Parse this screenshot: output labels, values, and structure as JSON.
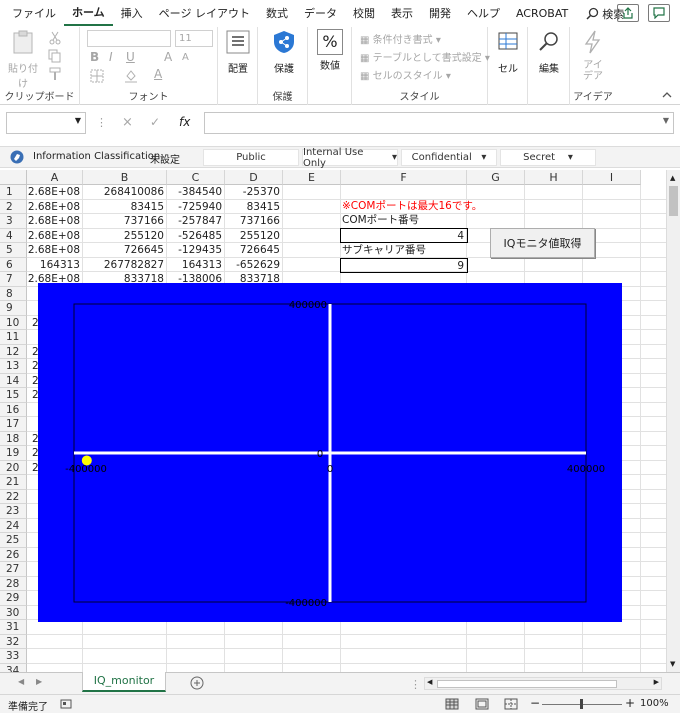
{
  "menu": {
    "items": [
      "ファイル",
      "ホーム",
      "挿入",
      "ページ レイアウト",
      "数式",
      "データ",
      "校閲",
      "表示",
      "開発",
      "ヘルプ",
      "ACROBAT"
    ],
    "active": "ホーム",
    "search": "検索"
  },
  "ribbon": {
    "clipboard": {
      "paste": "貼り付け",
      "label": "クリップボード"
    },
    "font": {
      "size": "11",
      "bold": "B",
      "italic": "I",
      "underline": "U",
      "grow": "A",
      "shrink": "A",
      "color_a": "A",
      "label": "フォント"
    },
    "alignment": {
      "btn": "配置"
    },
    "protect": {
      "btn": "保護",
      "label": "保護"
    },
    "number": {
      "btn": "数値",
      "sym": "%"
    },
    "styles": {
      "cond": "条件付き書式",
      "table": "テーブルとして書式設定",
      "cell": "セルのスタイル",
      "label": "スタイル"
    },
    "cells": {
      "btn": "セル"
    },
    "editing": {
      "btn": "編集"
    },
    "ideas": {
      "btn": "アイ\nデア",
      "label": "アイデア"
    }
  },
  "formula": {
    "fx": "fx",
    "cancel": "×",
    "confirm": "✓"
  },
  "classification": {
    "label": "Information Classification:",
    "value": "未設定",
    "buttons": [
      "Public",
      "Internal Use Only",
      "Confidential",
      "Secret"
    ]
  },
  "columns": [
    "A",
    "B",
    "C",
    "D",
    "E",
    "F",
    "G",
    "H",
    "I"
  ],
  "rows": [
    "1",
    "2",
    "3",
    "4",
    "5",
    "6",
    "7",
    "8",
    "9",
    "10",
    "11",
    "12",
    "13",
    "14",
    "15",
    "16",
    "17",
    "18",
    "19",
    "20",
    "21",
    "22",
    "23",
    "24",
    "25",
    "26",
    "27",
    "28",
    "29",
    "30",
    "31",
    "32",
    "33",
    "34"
  ],
  "cells": [
    [
      "2.68E+08",
      "268410086",
      "-384540",
      "-25370"
    ],
    [
      "2.68E+08",
      "83415",
      "-725940",
      "83415"
    ],
    [
      "2.68E+08",
      "737166",
      "-257847",
      "737166"
    ],
    [
      "2.68E+08",
      "255120",
      "-526485",
      "255120"
    ],
    [
      "2.68E+08",
      "726645",
      "-129435",
      "726645"
    ],
    [
      "164313",
      "267782827",
      "164313",
      "-652629"
    ],
    [
      "2.68E+08",
      "833718",
      "-138006",
      "833718"
    ]
  ],
  "partial_a": [
    "2",
    "2",
    "2",
    "2",
    "2",
    "2",
    "2",
    "2",
    "2",
    "2"
  ],
  "note": "※COMポートは最大16です。",
  "com_label": "COMポート番号",
  "com_value": "4",
  "sub_label": "サブキャリア番号",
  "sub_value": "9",
  "iq_button": "IQモニタ値取得",
  "plot_labels": {
    "ytop": "400000",
    "ybottom": "-400000",
    "xleft": "-400000",
    "xright": "400000",
    "origin": "0",
    "zero_small": "0"
  },
  "chart_data": {
    "type": "scatter",
    "x": [
      -400000,
      400000
    ],
    "ylim": [
      -400000,
      400000
    ],
    "xlim": [
      -400000,
      400000
    ],
    "series": [
      {
        "x": [
          -380000
        ],
        "y": [
          -20000
        ]
      }
    ],
    "colors": {
      "background": "#0000ff",
      "axis": "#ffffff",
      "point": "#ffff00"
    }
  },
  "sheet": {
    "tab": "IQ_monitor"
  },
  "status": {
    "ready": "準備完了",
    "zoom": "100%",
    "minus": "−",
    "plus": "+"
  }
}
